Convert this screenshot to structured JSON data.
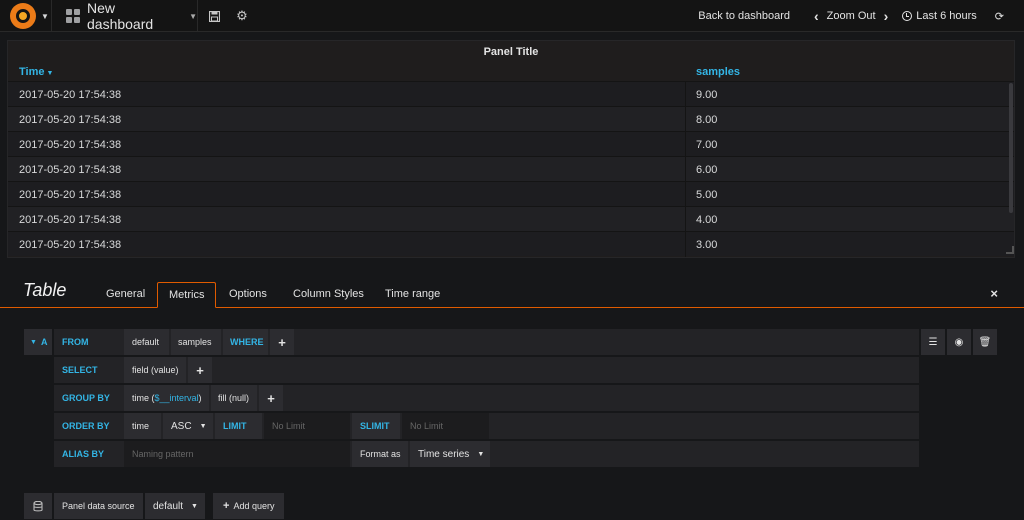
{
  "topbar": {
    "dashboard_title": "New dashboard",
    "back_label": "Back to dashboard",
    "zoom_out_label": "Zoom Out",
    "time_range_label": "Last 6 hours"
  },
  "panel": {
    "title": "Panel Title",
    "columns": [
      "Time",
      "samples"
    ],
    "rows": [
      {
        "time": "2017-05-20 17:54:38",
        "value": "9.00"
      },
      {
        "time": "2017-05-20 17:54:38",
        "value": "8.00"
      },
      {
        "time": "2017-05-20 17:54:38",
        "value": "7.00"
      },
      {
        "time": "2017-05-20 17:54:38",
        "value": "6.00"
      },
      {
        "time": "2017-05-20 17:54:38",
        "value": "5.00"
      },
      {
        "time": "2017-05-20 17:54:38",
        "value": "4.00"
      },
      {
        "time": "2017-05-20 17:54:38",
        "value": "3.00"
      }
    ]
  },
  "editor": {
    "title": "Table",
    "tabs": [
      "General",
      "Metrics",
      "Options",
      "Column Styles",
      "Time range"
    ],
    "active_tab": "Metrics",
    "close_symbol": "×"
  },
  "query": {
    "ref_id": "A",
    "from_kw": "FROM",
    "from_policy": "default",
    "from_measurement": "samples",
    "where_kw": "WHERE",
    "select_kw": "SELECT",
    "select_field": "field (value)",
    "group_by_kw": "GROUP BY",
    "group_time_prefix": "time (",
    "group_time_var": "$__interval",
    "group_time_suffix": ")",
    "group_fill": "fill (null)",
    "order_by_kw": "ORDER BY",
    "order_field": "time",
    "order_dir": "ASC",
    "limit_kw": "LIMIT",
    "limit_placeholder": "No Limit",
    "slimit_kw": "SLIMIT",
    "slimit_placeholder": "No Limit",
    "alias_kw": "ALIAS BY",
    "alias_placeholder": "Naming pattern",
    "format_label": "Format as",
    "format_value": "Time series",
    "plus": "+"
  },
  "footer": {
    "datasource_label": "Panel data source",
    "datasource_value": "default",
    "add_query_label": "Add query"
  },
  "colors": {
    "accent_blue": "#33b5e5",
    "tab_orange": "#e05b00",
    "logo_orange": "#eb7b18"
  }
}
